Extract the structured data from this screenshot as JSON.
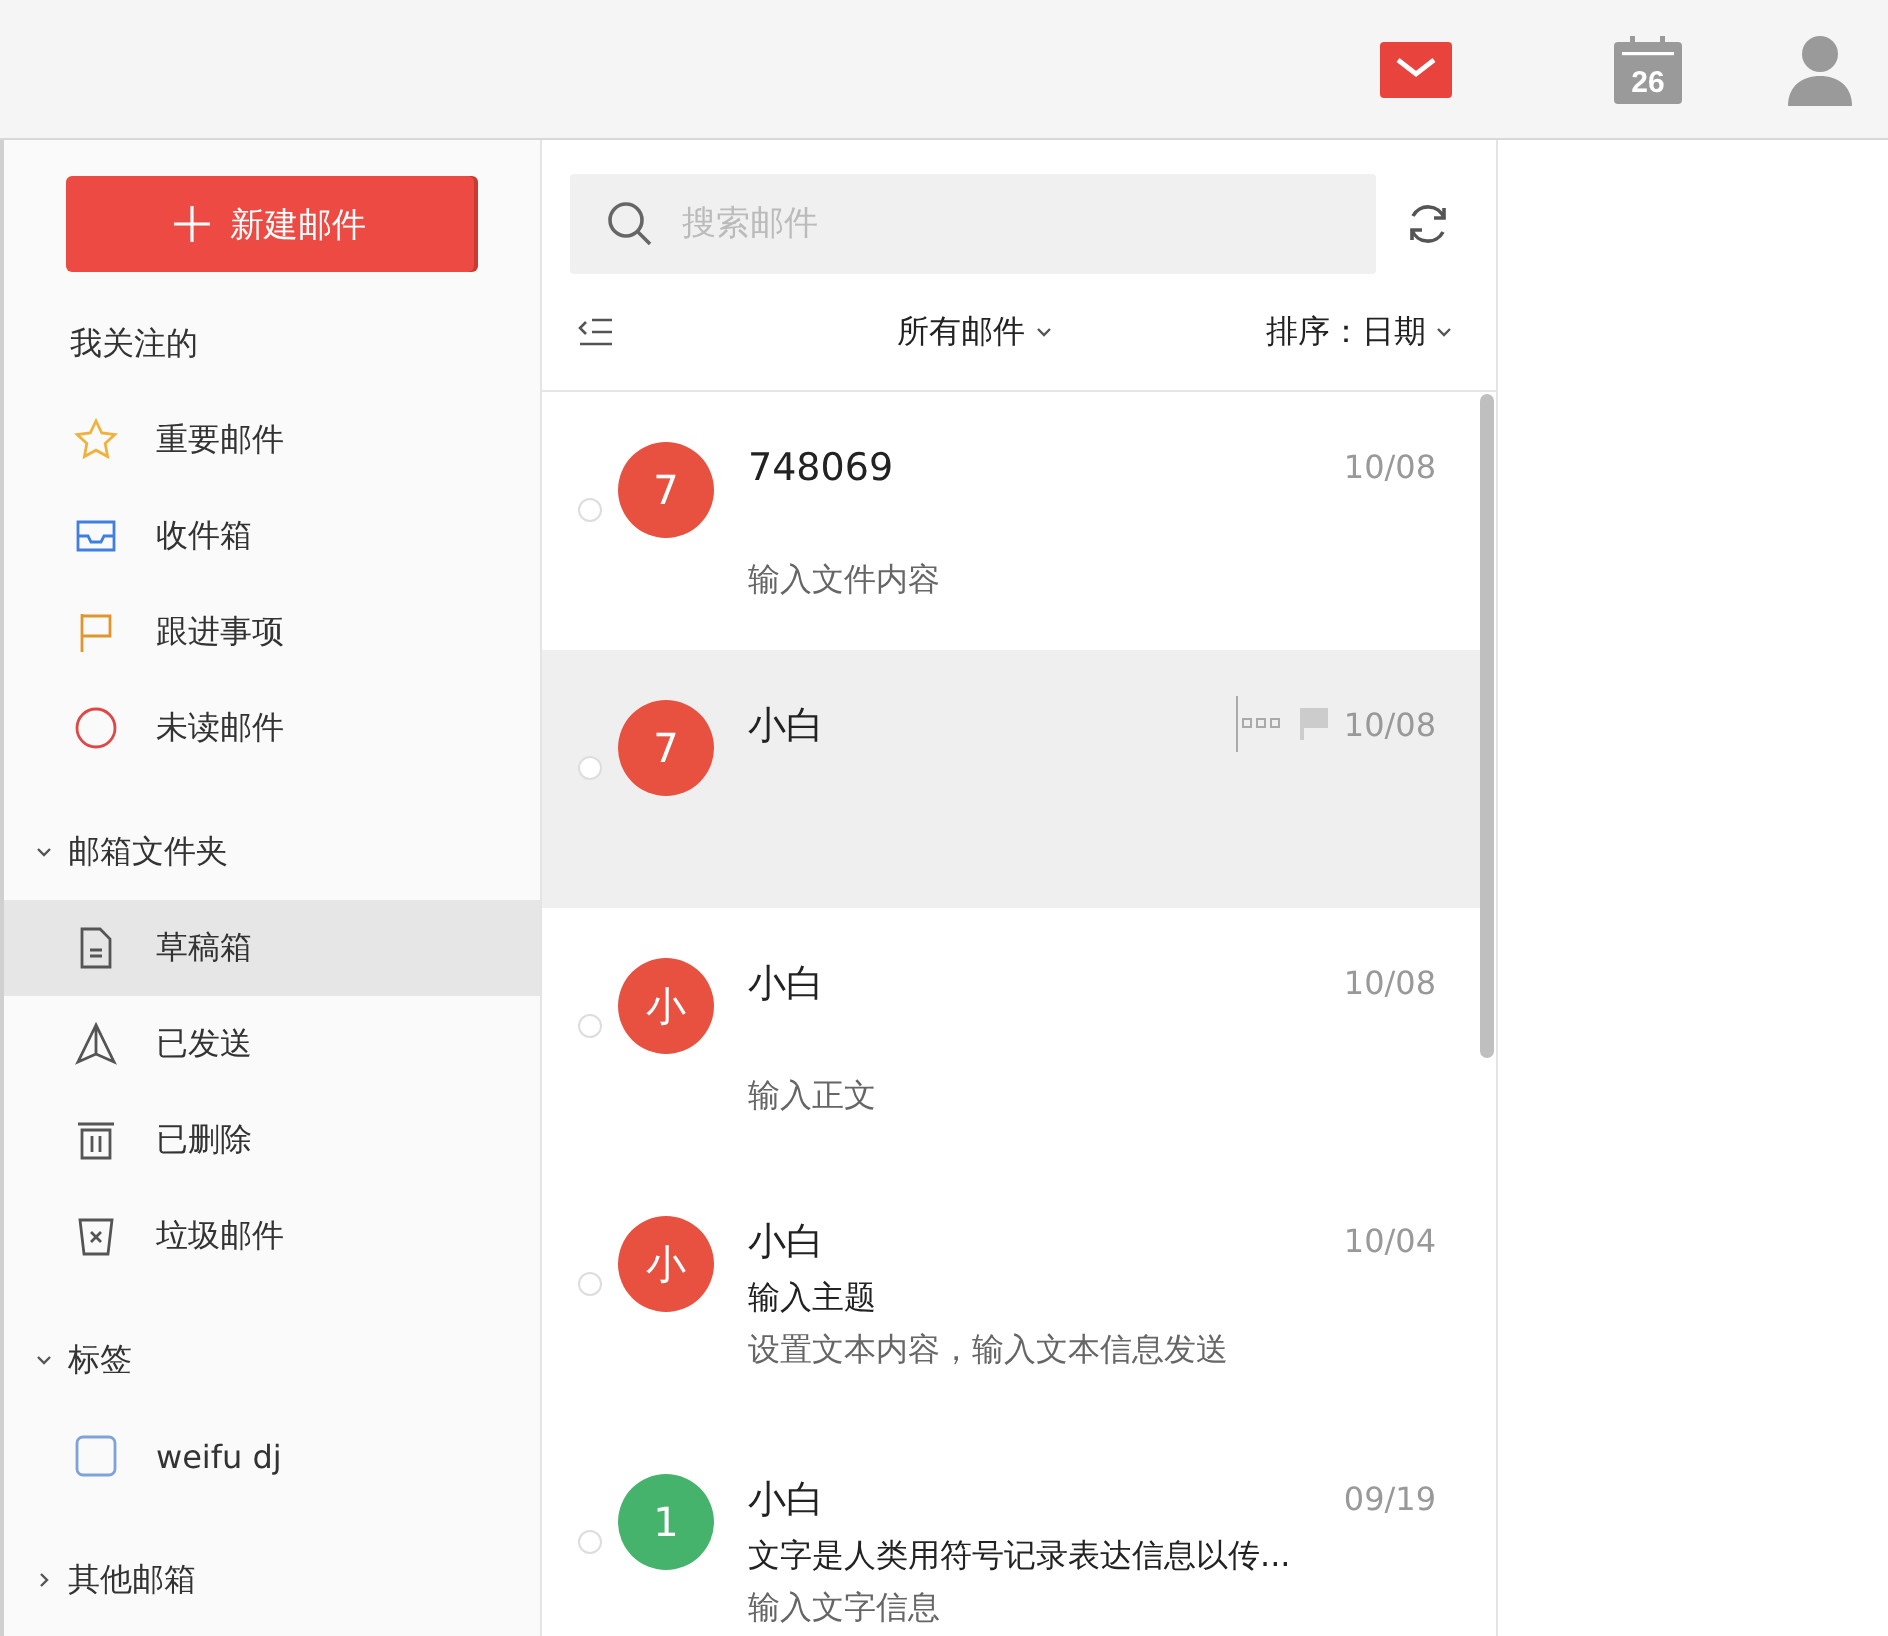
{
  "top_bar": {
    "apps": [
      {
        "kind": "mail",
        "selected": true
      },
      {
        "kind": "calendar",
        "selected": false,
        "label": "26"
      },
      {
        "kind": "contacts",
        "selected": false
      }
    ]
  },
  "sidebar": {
    "compose_button": "新建邮件",
    "sections": [
      {
        "title": "我关注的",
        "items": [
          {
            "label": "重要邮件",
            "selected": false
          },
          {
            "label": "收件箱",
            "selected": false
          },
          {
            "label": "跟进事项",
            "selected": false
          },
          {
            "label": "未读邮件",
            "selected": false
          }
        ]
      },
      {
        "title": "邮箱文件夹",
        "expanded": true,
        "items": [
          {
            "label": "草稿箱",
            "selected": true
          },
          {
            "label": "已发送",
            "selected": false
          },
          {
            "label": "已删除",
            "selected": false
          },
          {
            "label": "垃圾邮件",
            "selected": false
          }
        ]
      },
      {
        "title": "标签",
        "expanded": true,
        "items": [
          {
            "label": "weifu dj",
            "selected": false
          }
        ]
      },
      {
        "title": "其他邮箱",
        "expanded": false
      }
    ]
  },
  "mail_list": {
    "search": {
      "placeholder": "搜索邮件"
    },
    "filter": "所有邮件",
    "sort": "排序：日期",
    "messages": [
      {
        "avatar": "7",
        "color": "#e8503f",
        "sender": "748069",
        "date": "10/08",
        "preview": "输入文件内容",
        "selected": false,
        "hovered": false
      },
      {
        "avatar": "7",
        "color": "#e8503f",
        "sender": "小白",
        "date": "10/08",
        "selected": true,
        "hovered": true
      },
      {
        "avatar": "小",
        "color": "#e8503f",
        "sender": "小白",
        "date": "10/08",
        "preview": "输入正文",
        "selected": false,
        "hovered": false
      },
      {
        "avatar": "小",
        "color": "#e8503f",
        "sender": "小白",
        "date": "10/04",
        "subject": "输入主题",
        "preview": "设置文本内容，输入文本信息发送",
        "selected": false,
        "hovered": false
      },
      {
        "avatar": "1",
        "color": "#45b36b",
        "sender": "小白",
        "date": "09/19",
        "subject": "文字是人类用符号记录表达信息以传...",
        "preview": "输入文字信息",
        "selected": false,
        "hovered": false
      }
    ]
  }
}
